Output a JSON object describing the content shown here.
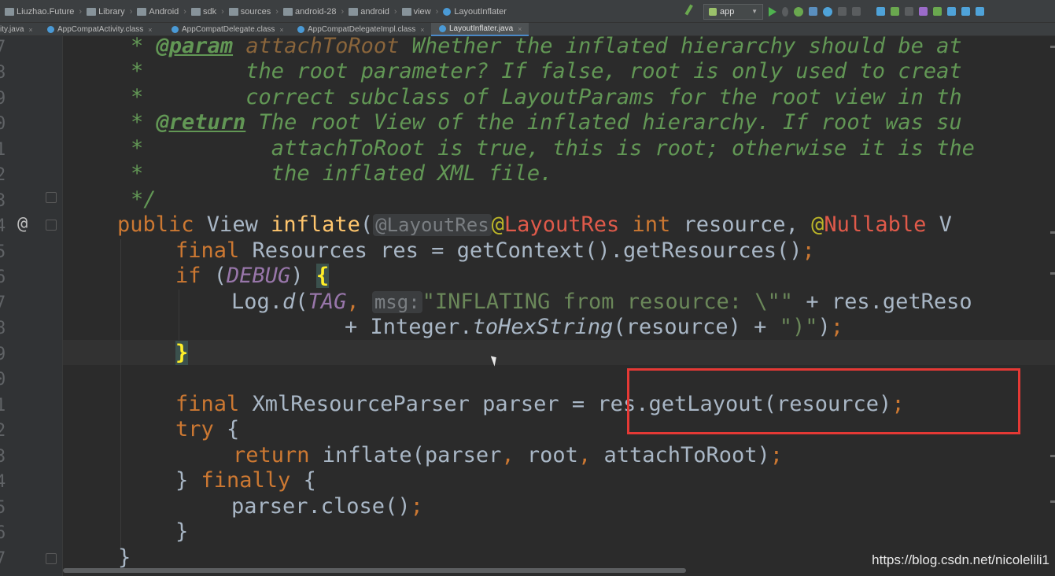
{
  "breadcrumbs": [
    "Liuzhao.Future",
    "Library",
    "Android",
    "sdk",
    "sources",
    "android-28",
    "android",
    "view",
    "LayoutInflater"
  ],
  "run_config": "app",
  "tabs": [
    {
      "label": "ity.java",
      "active": false
    },
    {
      "label": "AppCompatActivity.class",
      "active": false
    },
    {
      "label": "AppCompatDelegate.class",
      "active": false
    },
    {
      "label": "AppCompatDelegateImpl.class",
      "active": false
    },
    {
      "label": "LayoutInflater.java",
      "active": true
    }
  ],
  "line_numbers": [
    "7",
    "8",
    "9",
    "0",
    "1",
    "2",
    "3",
    "4",
    "5",
    "6",
    "7",
    "8",
    "9",
    "0",
    "1",
    "2",
    "3",
    "4",
    "5",
    "6",
    "7"
  ],
  "code": {
    "l1": {
      "star": "* ",
      "tag": "@param",
      "sp": " ",
      "name": "attachToRoot",
      "text": " Whether the inflated hierarchy should be at"
    },
    "l2": {
      "text": "*        the root parameter? If false, root is only used to creat"
    },
    "l3": {
      "text": "*        correct subclass of LayoutParams for the root view in th"
    },
    "l4": {
      "star": "* ",
      "tag": "@return",
      "text": " The root View of the inflated hierarchy. If root was su"
    },
    "l5": {
      "text": "*          attachToRoot is true, this is root; otherwise it is the"
    },
    "l6": {
      "text": "*          the inflated XML file."
    },
    "l7": {
      "text": "*/"
    },
    "l8": {
      "kw": "public",
      "type": " View ",
      "fn": "inflate",
      "p": "(",
      "hint": "@LayoutRes",
      "ann1": "@",
      "ann2": "LayoutRes",
      "kw2": " int",
      "rest": " resource, ",
      "ann3": "@",
      "ann4": "Nullable",
      "tail": " V"
    },
    "l9": {
      "kw": "final",
      "rest": " Resources res = getContext().getResources()",
      "semi": ";"
    },
    "l10": {
      "kw": "if",
      "p1": " (",
      "const": "DEBUG",
      "p2": ") ",
      "brace": "{"
    },
    "l11": {
      "a": "Log.",
      "fn": "d",
      "b": "(",
      "const": "TAG",
      "comma": ", ",
      "hint": "msg:",
      "str": "\"INFLATING from resource: \\\"\"",
      "rest": " + res.getReso"
    },
    "l12": {
      "a": "+ Integer.",
      "fn": "toHexString",
      "b": "(resource) + ",
      "str": "\")\"",
      "c": ")",
      "semi": ";"
    },
    "l13": {
      "brace": "}"
    },
    "l14": {
      "kw": "final",
      "rest": " XmlResourceParser parser = res.getLayout(resource)",
      "semi": ";"
    },
    "l15": {
      "kw": "try",
      "rest": " {"
    },
    "l16": {
      "kw": "return",
      "a": " inflate(parser",
      "c1": ",",
      "b": " root",
      "c2": ",",
      "c": " attachToRoot)",
      "semi": ";"
    },
    "l17": {
      "a": "} ",
      "kw": "finally",
      "b": " {"
    },
    "l18": {
      "a": "parser.close()",
      "semi": ";"
    },
    "l19": {
      "a": "}"
    },
    "l20": {
      "a": "}"
    }
  },
  "watermark": "https://blog.csdn.net/nicolelili1",
  "colors": {
    "highlight_box": "#e53935",
    "doc_comment": "#629755",
    "keyword": "#cc7832"
  }
}
